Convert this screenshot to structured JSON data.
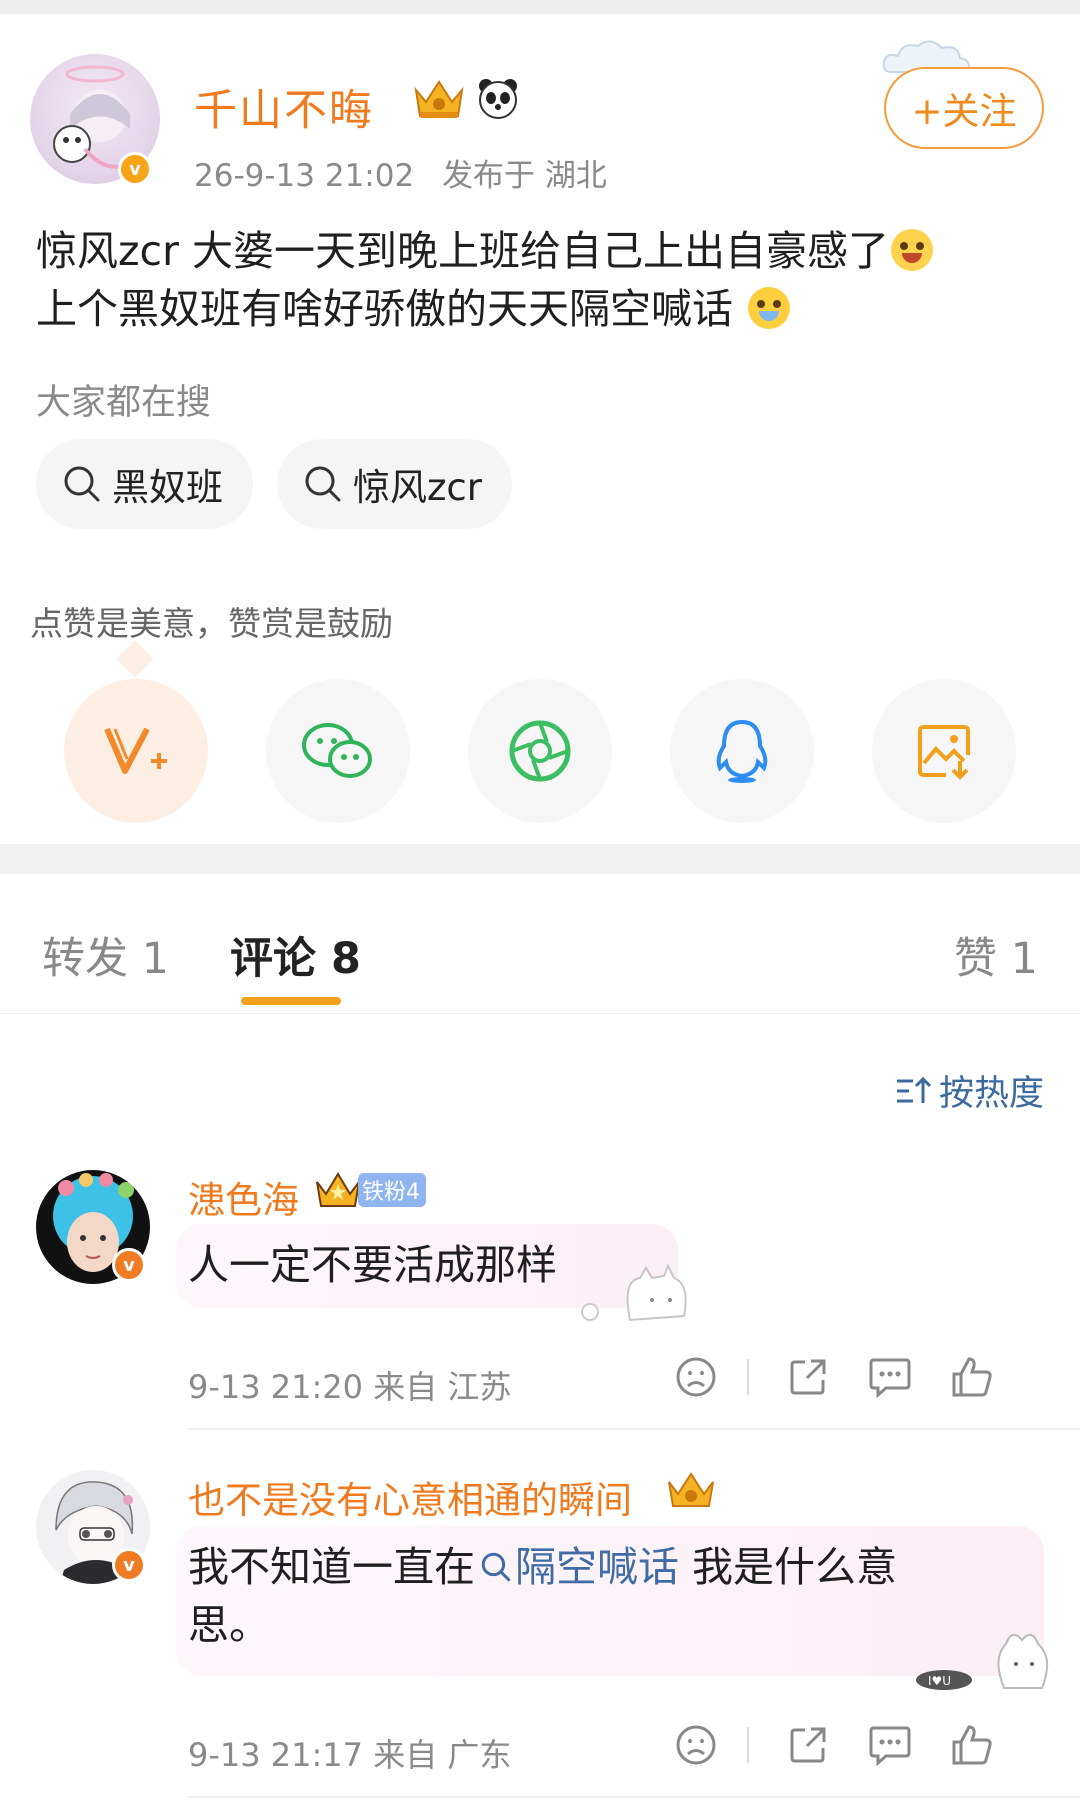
{
  "post": {
    "author": "千山不晦",
    "time": "26-9-13 21:02",
    "location": "发布于 湖北",
    "follow_label": "+关注",
    "text_line1": "惊风zcr 大婆一天到晚上班给自己上出自豪感了",
    "text_line2": "上个黑奴班有啥好骄傲的天天隔空喊话 ",
    "search_label": "大家都在搜",
    "search_chips": [
      "黑奴班",
      "惊风zcr"
    ],
    "tip": "点赞是美意，赞赏是鼓励",
    "share_icons": [
      "reward-v-icon",
      "wechat-icon",
      "moments-icon",
      "qq-icon",
      "save-image-icon"
    ]
  },
  "tabs": {
    "repost": "转发 1",
    "comments": "评论 8",
    "likes": "赞 1"
  },
  "sort_label": "按热度",
  "comments": [
    {
      "author": "漶色海",
      "fan_badge": "铁粉4",
      "text": "人一定不要活成那样",
      "meta": "9-13 21:20 来自 江苏"
    },
    {
      "author": "也不是没有心意相通的瞬间",
      "text_before": "我不知道一直在",
      "topic": "隔空喊话",
      "text_after": " 我是什么意",
      "text_line2": "思。",
      "meta": "9-13 21:17 来自 广东"
    }
  ],
  "colors": {
    "accent_orange": "#f07a1e",
    "link_blue": "#3f6ba6",
    "tab_underline": "#f6a11c"
  }
}
